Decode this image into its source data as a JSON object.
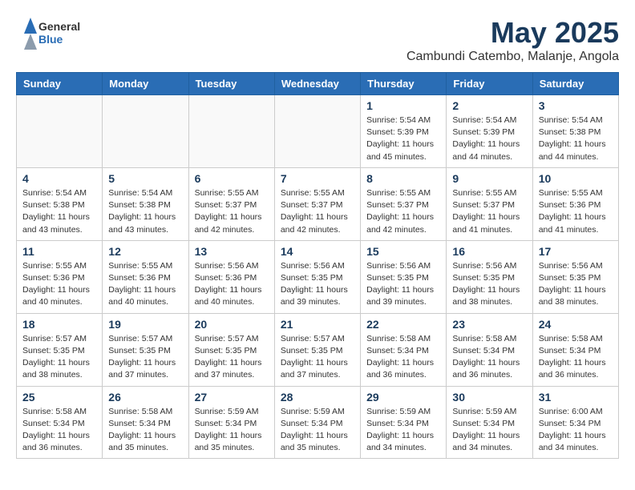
{
  "header": {
    "logo_general": "General",
    "logo_blue": "Blue",
    "month_title": "May 2025",
    "location": "Cambundi Catembo, Malanje, Angola"
  },
  "weekdays": [
    "Sunday",
    "Monday",
    "Tuesday",
    "Wednesday",
    "Thursday",
    "Friday",
    "Saturday"
  ],
  "weeks": [
    [
      {
        "day": "",
        "info": ""
      },
      {
        "day": "",
        "info": ""
      },
      {
        "day": "",
        "info": ""
      },
      {
        "day": "",
        "info": ""
      },
      {
        "day": "1",
        "info": "Sunrise: 5:54 AM\nSunset: 5:39 PM\nDaylight: 11 hours\nand 45 minutes."
      },
      {
        "day": "2",
        "info": "Sunrise: 5:54 AM\nSunset: 5:39 PM\nDaylight: 11 hours\nand 44 minutes."
      },
      {
        "day": "3",
        "info": "Sunrise: 5:54 AM\nSunset: 5:38 PM\nDaylight: 11 hours\nand 44 minutes."
      }
    ],
    [
      {
        "day": "4",
        "info": "Sunrise: 5:54 AM\nSunset: 5:38 PM\nDaylight: 11 hours\nand 43 minutes."
      },
      {
        "day": "5",
        "info": "Sunrise: 5:54 AM\nSunset: 5:38 PM\nDaylight: 11 hours\nand 43 minutes."
      },
      {
        "day": "6",
        "info": "Sunrise: 5:55 AM\nSunset: 5:37 PM\nDaylight: 11 hours\nand 42 minutes."
      },
      {
        "day": "7",
        "info": "Sunrise: 5:55 AM\nSunset: 5:37 PM\nDaylight: 11 hours\nand 42 minutes."
      },
      {
        "day": "8",
        "info": "Sunrise: 5:55 AM\nSunset: 5:37 PM\nDaylight: 11 hours\nand 42 minutes."
      },
      {
        "day": "9",
        "info": "Sunrise: 5:55 AM\nSunset: 5:37 PM\nDaylight: 11 hours\nand 41 minutes."
      },
      {
        "day": "10",
        "info": "Sunrise: 5:55 AM\nSunset: 5:36 PM\nDaylight: 11 hours\nand 41 minutes."
      }
    ],
    [
      {
        "day": "11",
        "info": "Sunrise: 5:55 AM\nSunset: 5:36 PM\nDaylight: 11 hours\nand 40 minutes."
      },
      {
        "day": "12",
        "info": "Sunrise: 5:55 AM\nSunset: 5:36 PM\nDaylight: 11 hours\nand 40 minutes."
      },
      {
        "day": "13",
        "info": "Sunrise: 5:56 AM\nSunset: 5:36 PM\nDaylight: 11 hours\nand 40 minutes."
      },
      {
        "day": "14",
        "info": "Sunrise: 5:56 AM\nSunset: 5:35 PM\nDaylight: 11 hours\nand 39 minutes."
      },
      {
        "day": "15",
        "info": "Sunrise: 5:56 AM\nSunset: 5:35 PM\nDaylight: 11 hours\nand 39 minutes."
      },
      {
        "day": "16",
        "info": "Sunrise: 5:56 AM\nSunset: 5:35 PM\nDaylight: 11 hours\nand 38 minutes."
      },
      {
        "day": "17",
        "info": "Sunrise: 5:56 AM\nSunset: 5:35 PM\nDaylight: 11 hours\nand 38 minutes."
      }
    ],
    [
      {
        "day": "18",
        "info": "Sunrise: 5:57 AM\nSunset: 5:35 PM\nDaylight: 11 hours\nand 38 minutes."
      },
      {
        "day": "19",
        "info": "Sunrise: 5:57 AM\nSunset: 5:35 PM\nDaylight: 11 hours\nand 37 minutes."
      },
      {
        "day": "20",
        "info": "Sunrise: 5:57 AM\nSunset: 5:35 PM\nDaylight: 11 hours\nand 37 minutes."
      },
      {
        "day": "21",
        "info": "Sunrise: 5:57 AM\nSunset: 5:35 PM\nDaylight: 11 hours\nand 37 minutes."
      },
      {
        "day": "22",
        "info": "Sunrise: 5:58 AM\nSunset: 5:34 PM\nDaylight: 11 hours\nand 36 minutes."
      },
      {
        "day": "23",
        "info": "Sunrise: 5:58 AM\nSunset: 5:34 PM\nDaylight: 11 hours\nand 36 minutes."
      },
      {
        "day": "24",
        "info": "Sunrise: 5:58 AM\nSunset: 5:34 PM\nDaylight: 11 hours\nand 36 minutes."
      }
    ],
    [
      {
        "day": "25",
        "info": "Sunrise: 5:58 AM\nSunset: 5:34 PM\nDaylight: 11 hours\nand 36 minutes."
      },
      {
        "day": "26",
        "info": "Sunrise: 5:58 AM\nSunset: 5:34 PM\nDaylight: 11 hours\nand 35 minutes."
      },
      {
        "day": "27",
        "info": "Sunrise: 5:59 AM\nSunset: 5:34 PM\nDaylight: 11 hours\nand 35 minutes."
      },
      {
        "day": "28",
        "info": "Sunrise: 5:59 AM\nSunset: 5:34 PM\nDaylight: 11 hours\nand 35 minutes."
      },
      {
        "day": "29",
        "info": "Sunrise: 5:59 AM\nSunset: 5:34 PM\nDaylight: 11 hours\nand 34 minutes."
      },
      {
        "day": "30",
        "info": "Sunrise: 5:59 AM\nSunset: 5:34 PM\nDaylight: 11 hours\nand 34 minutes."
      },
      {
        "day": "31",
        "info": "Sunrise: 6:00 AM\nSunset: 5:34 PM\nDaylight: 11 hours\nand 34 minutes."
      }
    ]
  ]
}
